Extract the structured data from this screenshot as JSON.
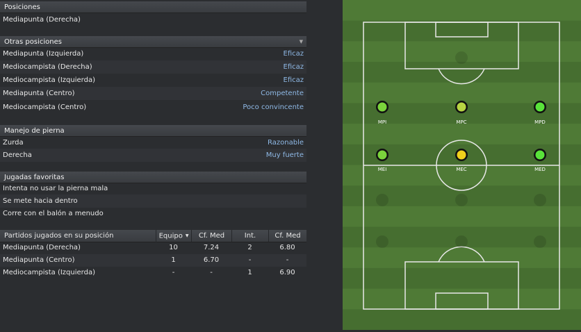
{
  "positions": {
    "header": "Posiciones",
    "main": "Mediapunta (Derecha)"
  },
  "other_positions": {
    "header": "Otras posiciones",
    "rows": [
      {
        "name": "Mediapunta (Izquierda)",
        "value": "Eficaz"
      },
      {
        "name": "Mediocampista (Derecha)",
        "value": "Eficaz"
      },
      {
        "name": "Mediocampista (Izquierda)",
        "value": "Eficaz"
      },
      {
        "name": "Mediapunta (Centro)",
        "value": "Competente"
      },
      {
        "name": "Mediocampista (Centro)",
        "value": "Poco convincente"
      }
    ]
  },
  "footedness": {
    "header": "Manejo de pierna",
    "rows": [
      {
        "name": "Zurda",
        "value": "Razonable"
      },
      {
        "name": "Derecha",
        "value": "Muy fuerte"
      }
    ]
  },
  "favourite_moves": {
    "header": "Jugadas favoritas",
    "rows": [
      "Intenta no usar la pierna mala",
      "Se mete hacia dentro",
      "Corre con el balón a menudo"
    ]
  },
  "matches_table": {
    "columns": [
      "Partidos jugados en su posición",
      "Equipo",
      "Cf. Med",
      "Int.",
      "Cf. Med"
    ],
    "rows": [
      [
        "Mediapunta (Derecha)",
        "10",
        "7.24",
        "2",
        "6.80"
      ],
      [
        "Mediapunta (Centro)",
        "1",
        "6.70",
        "-",
        "-"
      ],
      [
        "Mediocampista (Izquierda)",
        "-",
        "-",
        "1",
        "6.90"
      ]
    ]
  },
  "pitch": {
    "colors": {
      "grass_light": "#4f7a36",
      "grass_dark": "#466e30",
      "line": "#e8e8e8"
    },
    "markers": [
      {
        "label": "MPI",
        "color": "#7bd43c"
      },
      {
        "label": "MPC",
        "color": "#b7d443"
      },
      {
        "label": "MPD",
        "color": "#59e33a"
      },
      {
        "label": "MEI",
        "color": "#7bd43c"
      },
      {
        "label": "MEC",
        "color": "#f0d01c"
      },
      {
        "label": "MED",
        "color": "#59e33a"
      }
    ]
  }
}
